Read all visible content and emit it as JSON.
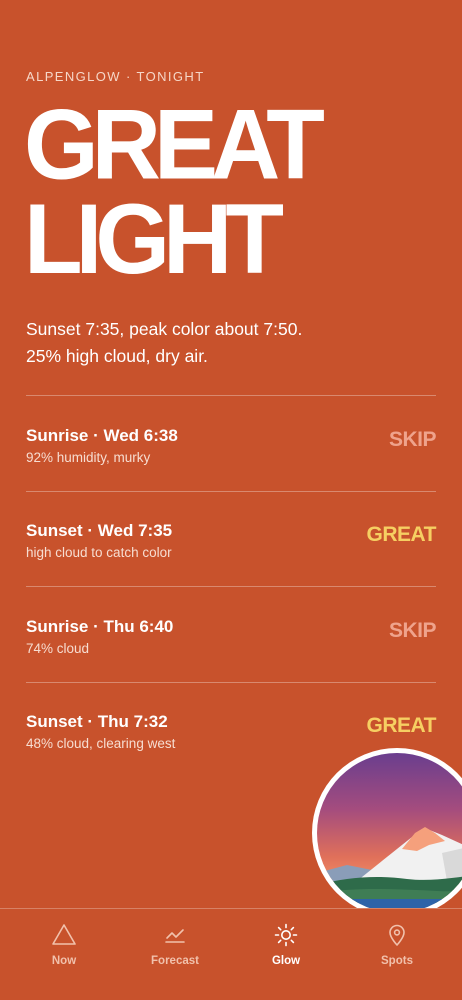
{
  "header": {
    "eyebrow": "ALPENGLOW · TONIGHT",
    "headline_line1": "GREAT",
    "headline_line2": "LIGHT"
  },
  "summary": {
    "line1": "Sunset 7:35, peak color about 7:50.",
    "line2": "25% high cloud, dry air."
  },
  "forecast": [
    {
      "title": "Sunrise · Wed 6:38",
      "detail": "92% humidity, murky",
      "verdict": "SKIP"
    },
    {
      "title": "Sunset · Wed 7:35",
      "detail": "high cloud to catch color",
      "verdict": "GREAT"
    },
    {
      "title": "Sunrise · Thu 6:40",
      "detail": "74% cloud",
      "verdict": "SKIP"
    },
    {
      "title": "Sunset · Thu 7:32",
      "detail": "48% cloud, clearing west",
      "verdict": "GREAT"
    }
  ],
  "badge": {
    "icon": "alpenglow-mountain-illustration"
  },
  "tabbar": {
    "active": "Glow",
    "tabs": [
      {
        "label": "Now",
        "icon": "triangle-icon"
      },
      {
        "label": "Forecast",
        "icon": "chart-line-icon"
      },
      {
        "label": "Glow",
        "icon": "sun-icon"
      },
      {
        "label": "Spots",
        "icon": "location-pin-icon"
      }
    ]
  },
  "colors": {
    "background": "#C8522C",
    "great": "#F6CF62",
    "skip": "#EFA38C",
    "text": "#FFFFFF"
  }
}
